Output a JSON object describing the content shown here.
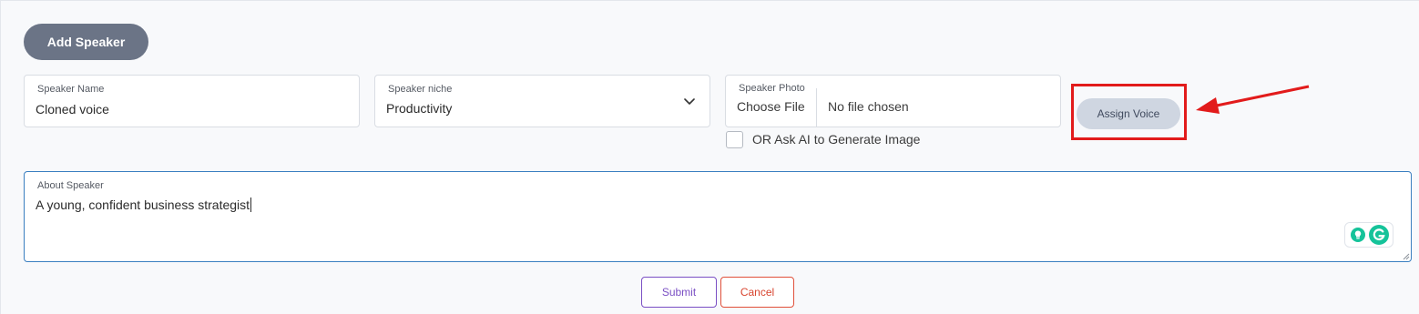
{
  "header": {
    "add_speaker_label": "Add Speaker"
  },
  "form": {
    "speaker_name": {
      "label": "Speaker Name",
      "value": "Cloned voice"
    },
    "speaker_niche": {
      "label": "Speaker niche",
      "value": "Productivity"
    },
    "speaker_photo": {
      "label": "Speaker Photo",
      "button_label": "Choose File",
      "file_status": "No file chosen"
    },
    "ai_image_checkbox": {
      "label": "OR Ask AI to Generate Image",
      "checked": false
    },
    "assign_voice_label": "Assign Voice",
    "about_speaker": {
      "label": "About Speaker",
      "value": "A young, confident business strategist"
    }
  },
  "actions": {
    "submit_label": "Submit",
    "cancel_label": "Cancel"
  },
  "icons": {
    "niche_dropdown": "chevron-down-icon",
    "grammarly_assist": "lightbulb-icon",
    "grammarly": "grammarly-logo-icon",
    "resize": "resize-handle-icon"
  },
  "colors": {
    "primary_button": "#6b7486",
    "assign_voice_bg": "#cfd6e1",
    "annotation_red": "#e21b1b",
    "submit_accent": "#7a4fc4",
    "cancel_accent": "#d8442e",
    "focus_border": "#3a7fc0",
    "grammarly_green": "#15c39a"
  }
}
